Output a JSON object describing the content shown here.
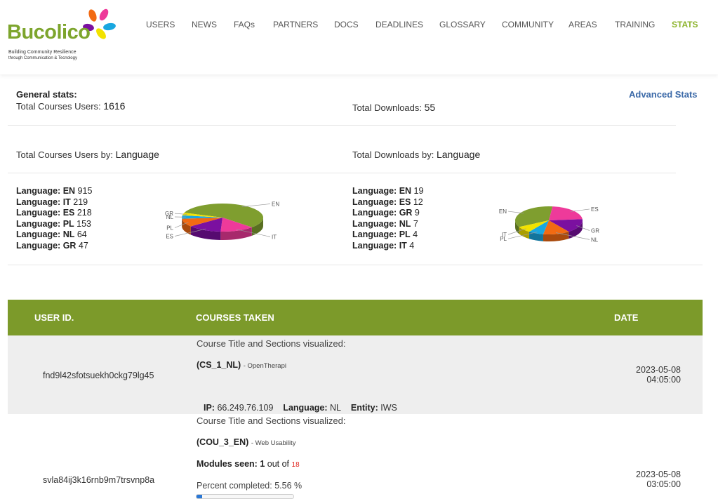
{
  "brand": {
    "name": "Bucolico",
    "tagline_1": "Building Community Resilience",
    "tagline_2": "through Communication & Tecnology"
  },
  "nav": {
    "items": [
      "USERS",
      "NEWS",
      "FAQs",
      "PARTNERS",
      "DOCS",
      "DEADLINES",
      "GLOSSARY",
      "COMMUNITY",
      "AREAS",
      "TRAINING",
      "STATS"
    ],
    "active": "STATS",
    "active_color": "#8cb32b"
  },
  "general": {
    "title": "General stats:",
    "users_label": "Total Courses Users:",
    "users_value": "1616",
    "downloads_label": "Total Downloads:",
    "downloads_value": "55",
    "advanced_link": "Advanced Stats"
  },
  "by_language": {
    "users_label": "Total Courses Users by:",
    "users_key": "Language",
    "downloads_label": "Total Downloads by:",
    "downloads_key": "Language"
  },
  "chart_data": [
    {
      "type": "pie",
      "title": "",
      "categories": [
        "EN",
        "IT",
        "ES",
        "PL",
        "NL",
        "GR"
      ],
      "values": [
        915,
        219,
        218,
        153,
        64,
        47
      ],
      "colors": [
        "#7f9e2f",
        "#ee3a9a",
        "#7b10a0",
        "#f26a12",
        "#19a7e0",
        "#f2e200"
      ]
    },
    {
      "type": "pie",
      "title": "",
      "categories": [
        "EN",
        "ES",
        "GR",
        "NL",
        "PL",
        "IT"
      ],
      "values": [
        19,
        12,
        9,
        7,
        4,
        4
      ],
      "colors": [
        "#7f9e2f",
        "#ee3a9a",
        "#7b10a0",
        "#f26a12",
        "#19a7e0",
        "#f2e200"
      ]
    }
  ],
  "lang_prefix": "Language:",
  "table": {
    "headers": {
      "user_id": "USER ID.",
      "courses": "COURSES TAKEN",
      "date": "DATE"
    },
    "header_color": "#7c9a2a",
    "rows": [
      {
        "user_id": "fnd9l42sfotsuekh0ckg79lg45",
        "sections_title": "Course Title and Sections visualized:",
        "course_code": "(CS_1_NL)",
        "course_name": "- OpenTherapi",
        "date": "2023-05-08",
        "time": "04:05:00",
        "ip_label": "IP:",
        "ip": "66.249.76.109",
        "lang_label": "Language:",
        "lang": "NL",
        "entity_label": "Entity:",
        "entity": "IWS"
      },
      {
        "user_id": "svla84ij3k16rnb9m7trsvnp8a",
        "sections_title": "Course Title and Sections visualized:",
        "course_code": "(COU_3_EN)",
        "course_name": "- Web Usability",
        "modules_label": "Modules seen:",
        "modules_seen": "1",
        "modules_outof": "out of",
        "modules_total": "18",
        "percent_label": "Percent completed:",
        "percent_value": "5.56 %",
        "progress_fraction": 0.0556,
        "date": "2023-05-08",
        "time": "03:05:00"
      }
    ]
  }
}
